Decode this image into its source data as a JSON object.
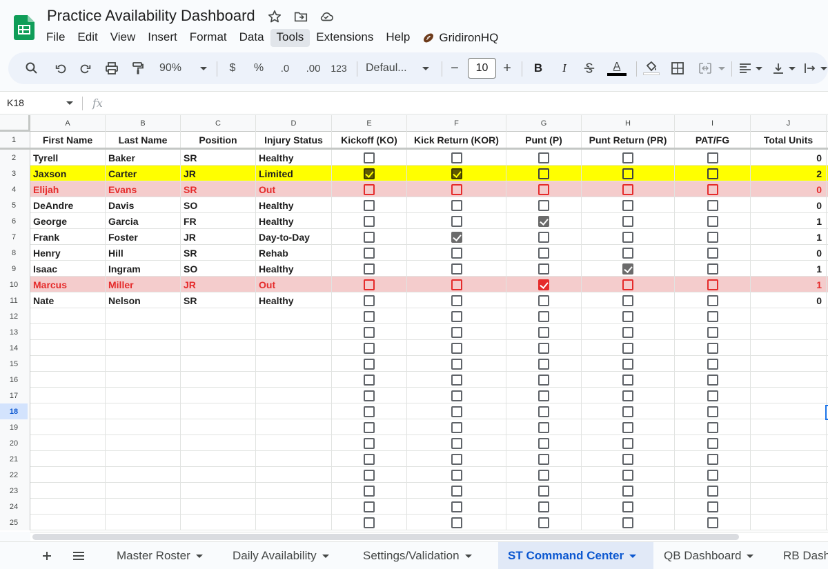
{
  "title": "Practice Availability Dashboard",
  "menu": [
    "File",
    "Edit",
    "View",
    "Insert",
    "Format",
    "Data",
    "Tools",
    "Extensions",
    "Help"
  ],
  "menu_active": "Tools",
  "extension_label": "GridironHQ",
  "toolbar": {
    "zoom": "90%",
    "currency": "$",
    "percent": "%",
    "decrease_decimal": ".0",
    "increase_decimal": ".00",
    "number_format": "123",
    "font": "Defaul...",
    "font_size": "10",
    "minus": "−",
    "plus": "+",
    "bold": "B",
    "italic": "I",
    "text_color_letter": "A"
  },
  "formula_bar": {
    "cell_ref": "K18",
    "fx": "fx",
    "value": ""
  },
  "columns": [
    "A",
    "B",
    "C",
    "D",
    "E",
    "F",
    "G",
    "H",
    "I",
    "J"
  ],
  "header": [
    "First Name",
    "Last Name",
    "Position",
    "Injury Status",
    "Kickoff (KO)",
    "Kick Return (KOR)",
    "Punt (P)",
    "Punt Return (PR)",
    "PAT/FG",
    "Total Units"
  ],
  "rows": [
    {
      "num": "2",
      "first": "Tyrell",
      "last": "Baker",
      "pos": "SR",
      "status": "Healthy",
      "checks": [
        false,
        false,
        false,
        false,
        false
      ],
      "total": "0",
      "style": "normal"
    },
    {
      "num": "3",
      "first": "Jaxson",
      "last": "Carter",
      "pos": "JR",
      "status": "Limited",
      "checks": [
        true,
        true,
        false,
        false,
        false
      ],
      "total": "2",
      "style": "yellow"
    },
    {
      "num": "4",
      "first": "Elijah",
      "last": "Evans",
      "pos": "SR",
      "status": "Out",
      "checks": [
        false,
        false,
        false,
        false,
        false
      ],
      "total": "0",
      "style": "red"
    },
    {
      "num": "5",
      "first": "DeAndre",
      "last": "Davis",
      "pos": "SO",
      "status": "Healthy",
      "checks": [
        false,
        false,
        false,
        false,
        false
      ],
      "total": "0",
      "style": "normal"
    },
    {
      "num": "6",
      "first": "George",
      "last": "Garcia",
      "pos": "FR",
      "status": "Healthy",
      "checks": [
        false,
        false,
        true,
        false,
        false
      ],
      "total": "1",
      "style": "normal"
    },
    {
      "num": "7",
      "first": "Frank",
      "last": "Foster",
      "pos": "JR",
      "status": "Day-to-Day",
      "checks": [
        false,
        true,
        false,
        false,
        false
      ],
      "total": "1",
      "style": "normal"
    },
    {
      "num": "8",
      "first": "Henry",
      "last": "Hill",
      "pos": "SR",
      "status": "Rehab",
      "checks": [
        false,
        false,
        false,
        false,
        false
      ],
      "total": "0",
      "style": "normal"
    },
    {
      "num": "9",
      "first": "Isaac",
      "last": "Ingram",
      "pos": "SO",
      "status": "Healthy",
      "checks": [
        false,
        false,
        false,
        true,
        false
      ],
      "total": "1",
      "style": "normal"
    },
    {
      "num": "10",
      "first": "Marcus",
      "last": "Miller",
      "pos": "JR",
      "status": "Out",
      "checks": [
        false,
        false,
        true,
        false,
        false
      ],
      "total": "1",
      "style": "red"
    },
    {
      "num": "11",
      "first": "Nate",
      "last": "Nelson",
      "pos": "SR",
      "status": "Healthy",
      "checks": [
        false,
        false,
        false,
        false,
        false
      ],
      "total": "0",
      "style": "normal"
    }
  ],
  "empty_rows": [
    "12",
    "13",
    "14",
    "15",
    "16",
    "17",
    "18",
    "19",
    "20",
    "21",
    "22",
    "23",
    "24",
    "25"
  ],
  "selected_row": "18",
  "sheet_tabs": [
    {
      "label": "Master Roster",
      "active": false
    },
    {
      "label": "Daily Availability",
      "active": false
    },
    {
      "label": "Settings/Validation",
      "active": false
    },
    {
      "label": "ST Command Center",
      "active": true
    },
    {
      "label": "QB Dashboard",
      "active": false
    },
    {
      "label": "RB Dash",
      "active": false
    }
  ],
  "colors": {
    "brand_green": "#0f9d58",
    "highlight_yellow": "#ffff00",
    "highlight_red_fill": "#f4cccc",
    "highlight_red_text": "#e52b2b",
    "accent_blue": "#0b57d0"
  }
}
